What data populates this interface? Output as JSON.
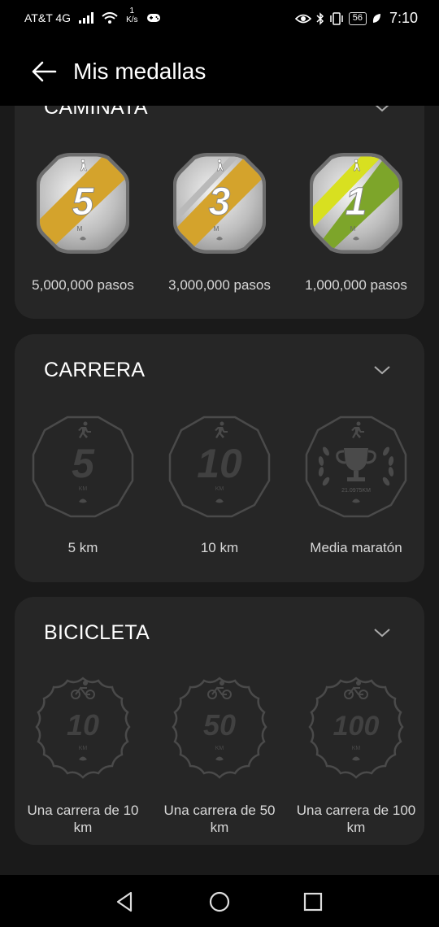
{
  "status_bar": {
    "carrier": "AT&T 4G",
    "speed_value": "1",
    "speed_unit": "K/s",
    "battery": "56",
    "time": "7:10"
  },
  "header": {
    "title": "Mis medallas"
  },
  "sections": [
    {
      "title": "CAMINATA",
      "medals": [
        {
          "number": "5",
          "unit": "M",
          "label": "5,000,000 pasos",
          "icon": "walking-icon"
        },
        {
          "number": "3",
          "unit": "M",
          "label": "3,000,000 pasos",
          "icon": "walking-icon"
        },
        {
          "number": "1",
          "unit": "M",
          "label": "1,000,000 pasos",
          "icon": "walking-icon"
        }
      ]
    },
    {
      "title": "CARRERA",
      "medals": [
        {
          "number": "5",
          "unit": "KM",
          "label": "5 km",
          "icon": "running-icon"
        },
        {
          "number": "10",
          "unit": "KM",
          "label": "10 km",
          "icon": "running-icon"
        },
        {
          "number": "",
          "unit": "21.0975KM",
          "label": "Media maratón",
          "icon": "trophy-icon"
        }
      ]
    },
    {
      "title": "BICICLETA",
      "medals": [
        {
          "number": "10",
          "unit": "KM",
          "label": "Una carrera de 10 km",
          "icon": "cycling-icon"
        },
        {
          "number": "50",
          "unit": "KM",
          "label": "Una carrera de 50 km",
          "icon": "cycling-icon"
        },
        {
          "number": "100",
          "unit": "KM",
          "label": "Una carrera de 100 km",
          "icon": "cycling-icon"
        }
      ]
    }
  ],
  "colors": {
    "background": "#1a1a1a",
    "card": "#262626",
    "gold_stripe": "#d4a32c",
    "yellow_stripe": "#d8e020",
    "green_stripe": "#7da52a",
    "locked_outline": "#4a4a4a"
  }
}
